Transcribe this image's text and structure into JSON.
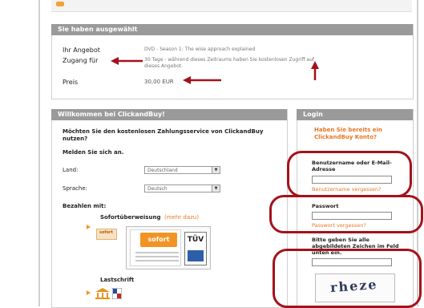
{
  "selection": {
    "header": "Sie haben ausgewählt",
    "rows": [
      {
        "label": "Ihr Angebot",
        "value": "DVD - Season 1: The wise approach explained"
      },
      {
        "label": "Zugang für",
        "value": "30 Tage - während dieses Zeitraums haben Sie kostenlosen Zugriff auf dieses Angebot."
      },
      {
        "label": "Preis",
        "value": "30,00 EUR"
      }
    ]
  },
  "welcome": {
    "header": "Willkommen bei ClickandBuy!",
    "question": "Möchten Sie den kostenlosen Zahlungsservice von ClickandBuy nutzen?",
    "signup": "Melden Sie sich an.",
    "fields": [
      {
        "label": "Land:",
        "value": "Deutschland"
      },
      {
        "label": "Sprache:",
        "value": "Deutsch"
      }
    ],
    "pay_with": "Bezahlen mit:",
    "method1_title": "Sofortüberweisung",
    "method1_link": "(mehr dazu)",
    "sofort_logo": "sofort",
    "tuv": "TÜV",
    "method2_title": "Lastschrift",
    "small_logo_text": "sofort"
  },
  "login": {
    "header": "Login",
    "prompt": "Haben Sie bereits ein ClickandBuy Konto?",
    "user_label": "Benutzername oder E-Mail-Adresse",
    "user_forgot": "Benutzername vergessen?",
    "pass_label": "Passwort",
    "pass_forgot": "Passwort vergessen?",
    "captcha_instructions": "Bitte geben Sie alle abgebildeten Zeichen im Feld unten ein.",
    "captcha_text": "rheze"
  },
  "colors": {
    "header_bg": "#9a9a9a",
    "accent_orange": "#e87722",
    "annotation_red": "#a3121b"
  }
}
